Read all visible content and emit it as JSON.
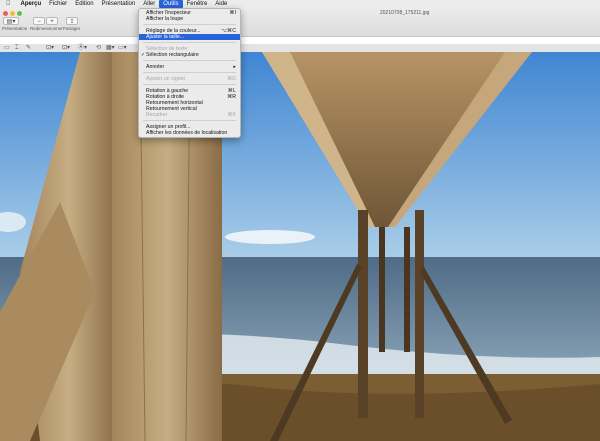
{
  "menubar": {
    "apple_icon": "",
    "items": [
      "Aperçu",
      "Fichier",
      "Edition",
      "Présentation",
      "Aller",
      "Outils",
      "Fenêtre",
      "Aide"
    ],
    "active": "Outils"
  },
  "window": {
    "title": "20210708_175211.jpg",
    "toolbar": {
      "presentation_label": "Présentation",
      "redimensionner_label": "Redimensionner",
      "partager_label": "Partager",
      "zoom_out": "−",
      "zoom_in": "+",
      "share_icon": "⇪",
      "sidebar_icon": "▤▾"
    },
    "markup": {
      "icons": [
        "▭",
        "⌶",
        "✎",
        "⊡▾",
        "⊡▾",
        "Ⓐ▾",
        "⟲",
        "▦▾",
        "▭▾",
        "A▾",
        "Ⓐ",
        "⤢"
      ]
    }
  },
  "tools_menu": {
    "items": [
      {
        "label": "Afficher l'inspecteur",
        "shortcut": "⌘I",
        "disabled": false
      },
      {
        "label": "Afficher la loupe",
        "shortcut": "",
        "disabled": false
      },
      {
        "label": "Réglage de la couleur...",
        "shortcut": "⌥⌘C",
        "disabled": false
      },
      {
        "label": "Ajuster la taille...",
        "shortcut": "",
        "disabled": false,
        "highlighted": true
      },
      {
        "label": "Sélection de texte",
        "shortcut": "",
        "disabled": true
      },
      {
        "label": "Sélection rectangulaire",
        "shortcut": "",
        "disabled": false,
        "checked": true
      },
      {
        "label": "Annoter",
        "shortcut": "▸",
        "disabled": false
      },
      {
        "label": "Ajouter un signet",
        "shortcut": "⌘D",
        "disabled": true
      },
      {
        "label": "Rotation à gauche",
        "shortcut": "⌘L",
        "disabled": false
      },
      {
        "label": "Rotation à droite",
        "shortcut": "⌘R",
        "disabled": false
      },
      {
        "label": "Retournement horizontal",
        "shortcut": "",
        "disabled": false
      },
      {
        "label": "Retournement vertical",
        "shortcut": "",
        "disabled": false
      },
      {
        "label": "Recadrer",
        "shortcut": "⌘K",
        "disabled": true
      },
      {
        "label": "Assigner un profil...",
        "shortcut": "",
        "disabled": false
      },
      {
        "label": "Afficher les données de localisation",
        "shortcut": "",
        "disabled": false
      }
    ],
    "check_glyph": "✓"
  },
  "colors": {
    "accent": "#2a63d8",
    "sky": "#4d95d8",
    "sea": "#6d8aa3"
  }
}
